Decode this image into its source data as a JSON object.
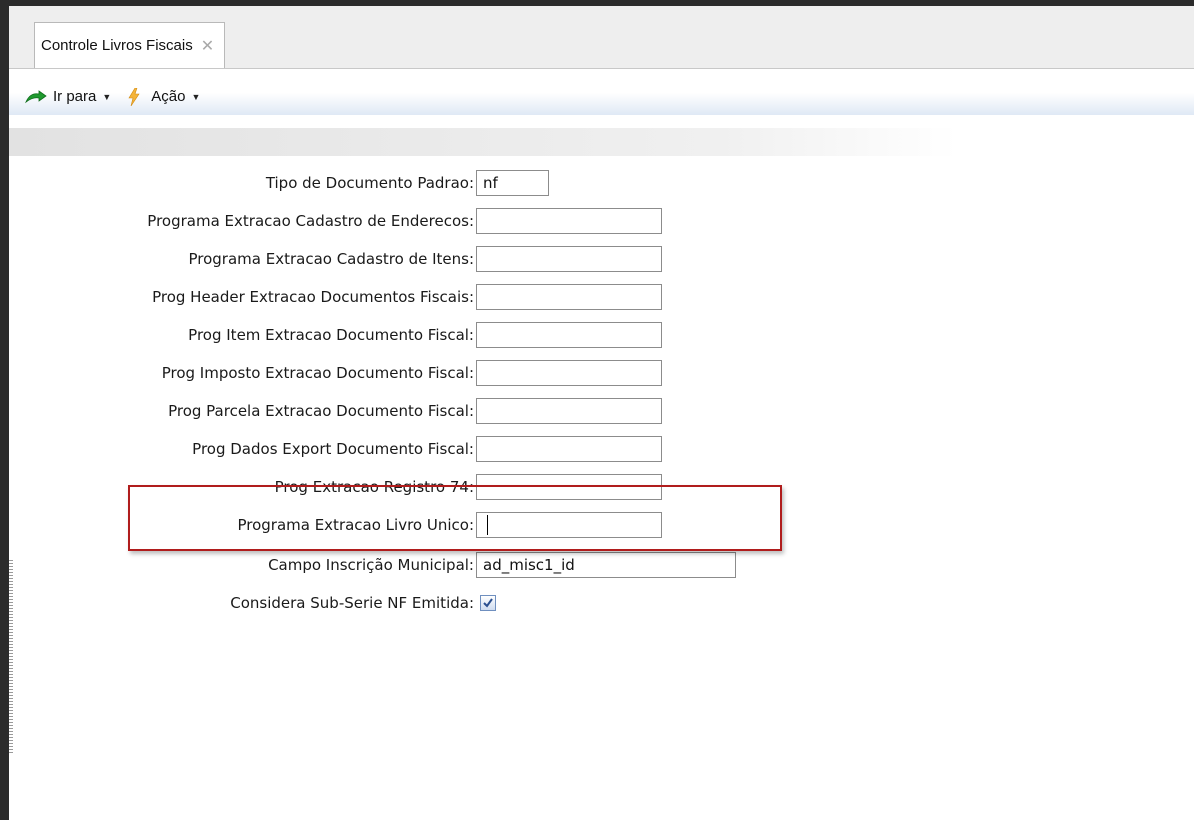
{
  "tab": {
    "title": "Controle Livros Fiscais",
    "close_icon": "close-icon"
  },
  "toolbar": {
    "goto_label": "Ir para",
    "goto_icon": "arrow-go-icon",
    "action_label": "Ação",
    "action_icon": "lightning-bolt-icon"
  },
  "form": {
    "fields": [
      {
        "label": "Tipo de Documento Padrao:",
        "value": "nf"
      },
      {
        "label": "Programa Extracao Cadastro de Enderecos:",
        "value": ""
      },
      {
        "label": "Programa Extracao Cadastro de Itens:",
        "value": ""
      },
      {
        "label": "Prog Header Extracao Documentos Fiscais:",
        "value": ""
      },
      {
        "label": "Prog Item Extracao Documento Fiscal:",
        "value": ""
      },
      {
        "label": "Prog Imposto Extracao Documento Fiscal:",
        "value": ""
      },
      {
        "label": "Prog Parcela Extracao Documento Fiscal:",
        "value": ""
      },
      {
        "label": "Prog Dados Export Documento Fiscal:",
        "value": ""
      },
      {
        "label": "Prog Extracao Registro 74:",
        "value": ""
      },
      {
        "label": "Programa Extracao Livro Unico:",
        "value": ""
      },
      {
        "label": "Campo Inscrição Municipal:",
        "value": "ad_misc1_id"
      }
    ],
    "checkbox": {
      "label": "Considera Sub-Serie NF Emitida:",
      "checked": true
    }
  },
  "colors": {
    "highlight_border": "#b01c1c",
    "toolbar_gradient_end": "#dfe9f5"
  }
}
